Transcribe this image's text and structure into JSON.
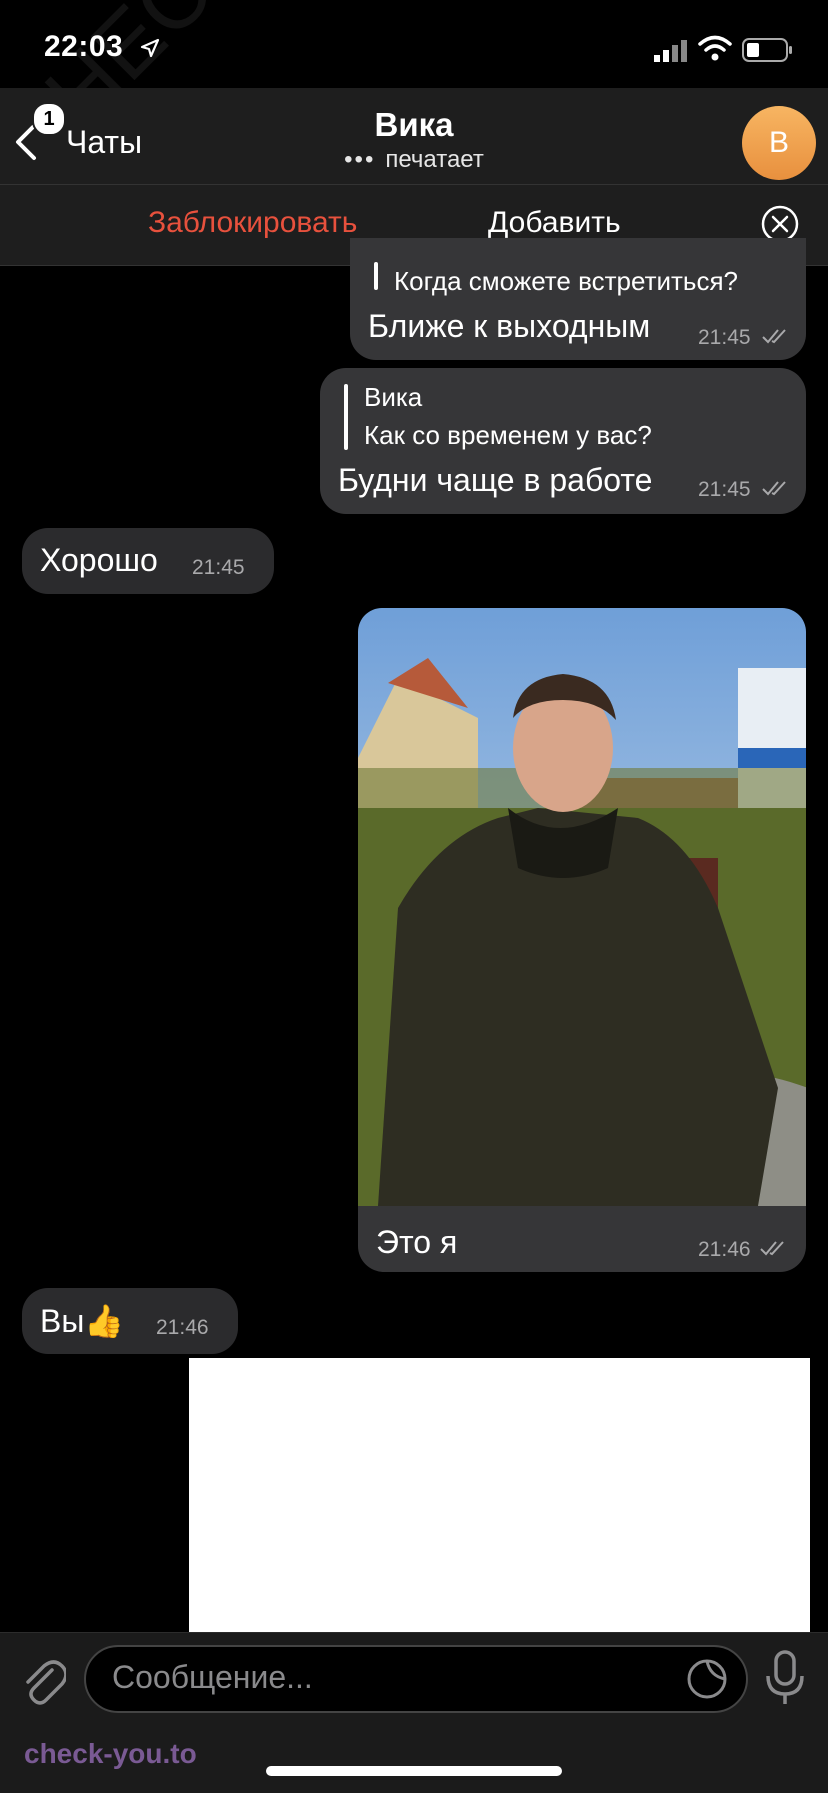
{
  "status_bar": {
    "time": "22:03"
  },
  "header": {
    "back_label": "Чаты",
    "back_badge": "1",
    "title": "Вика",
    "subtitle": "печатает",
    "typing_dots": "•••",
    "avatar_letter": "В",
    "avatar_color": "#f0a24f"
  },
  "action_bar": {
    "block_label": "Заблокировать",
    "add_label": "Добавить",
    "block_color": "#e8513d"
  },
  "messages": [
    {
      "direction": "out",
      "reply_text": "Когда сможете встретиться?",
      "text": "Ближе к выходным",
      "time": "21:45",
      "read": true
    },
    {
      "direction": "out",
      "reply_name": "Вика",
      "reply_text": "Как со временем у вас?",
      "text": "Будни чаще в работе",
      "time": "21:45",
      "read": true
    },
    {
      "direction": "in",
      "text": "Хорошо",
      "time": "21:45"
    },
    {
      "direction": "out",
      "type": "photo",
      "caption": "Это я",
      "time": "21:46",
      "read": true
    },
    {
      "direction": "in",
      "text": "Вы👍",
      "time": "21:46"
    }
  ],
  "input": {
    "placeholder": "Сообщение..."
  },
  "watermarks": {
    "diagonal": "CHECK-YOU.ME",
    "bottom": "check-you.to"
  }
}
